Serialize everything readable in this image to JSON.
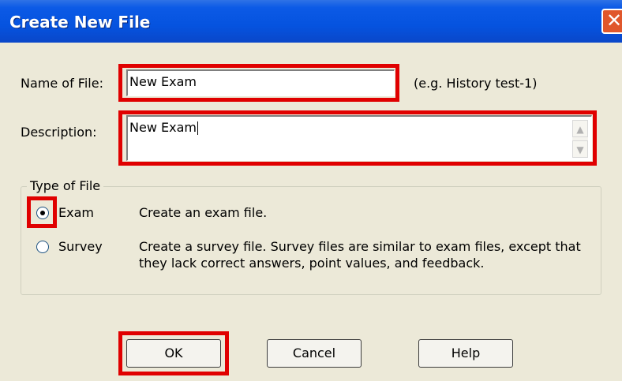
{
  "window": {
    "title": "Create New File",
    "close_glyph": "✕"
  },
  "form": {
    "name_label": "Name of File:",
    "name_value": "New Exam",
    "name_hint": "(e.g. History test-1)",
    "description_label": "Description:",
    "description_value": "New Exam"
  },
  "type_of_file": {
    "legend": "Type of File",
    "options": [
      {
        "label": "Exam",
        "description": "Create an exam file.",
        "selected": true
      },
      {
        "label": "Survey",
        "description_line1": "Create a survey file.  Survey files are similar to exam files, except that",
        "description_line2": "they lack correct answers, point values, and feedback.",
        "selected": false
      }
    ]
  },
  "buttons": {
    "ok": "OK",
    "cancel": "Cancel",
    "help": "Help"
  },
  "colors": {
    "titlebar": "#0553df",
    "dialog_bg": "#ece9d8",
    "highlight": "#e00000"
  }
}
